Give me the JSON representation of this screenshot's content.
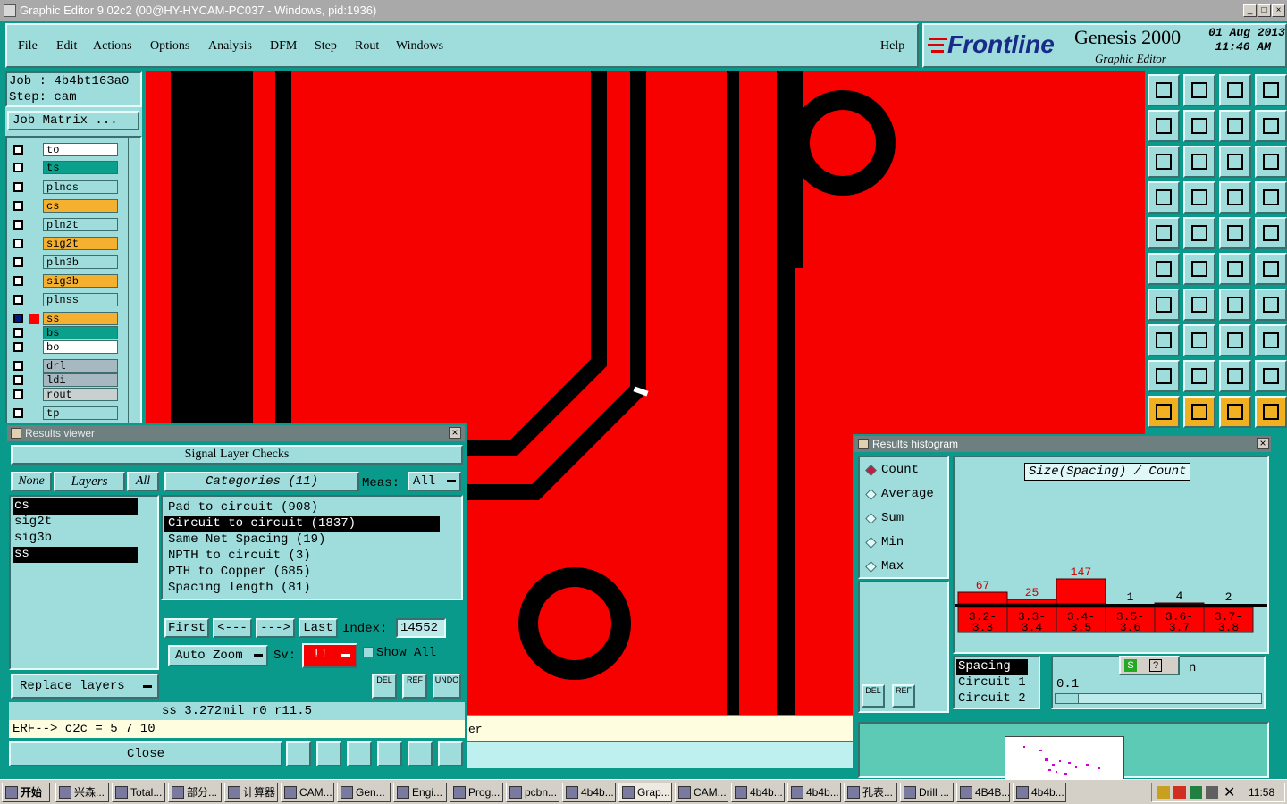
{
  "window": {
    "title": "Graphic Editor 9.02c2 (00@HY-HYCAM-PC037 - Windows, pid:1936)",
    "min": "_",
    "max": "□",
    "close": "×"
  },
  "menu": {
    "items": [
      "File",
      "Edit",
      "Actions",
      "Options",
      "Analysis",
      "DFM",
      "Step",
      "Rout",
      "Windows"
    ],
    "help": "Help"
  },
  "logo": {
    "brand": "Frontline",
    "product": "Genesis 2000",
    "subtitle": "Graphic Editor",
    "date": "01 Aug 2013",
    "time": "11:46 AM"
  },
  "job": {
    "job_line": "Job : 4b4bt163a0",
    "step_line": "Step: cam",
    "matrix_button": "Job Matrix ..."
  },
  "layers": [
    {
      "name": "to",
      "color": "#ffffff"
    },
    {
      "name": "ts",
      "color": "#0aa08c"
    },
    {
      "name": "plncs",
      "color": "#9fdcdc"
    },
    {
      "name": "cs",
      "color": "#f6b030"
    },
    {
      "name": "pln2t",
      "color": "#9fdcdc"
    },
    {
      "name": "sig2t",
      "color": "#f6b030"
    },
    {
      "name": "pln3b",
      "color": "#9fdcdc"
    },
    {
      "name": "sig3b",
      "color": "#f6b030"
    },
    {
      "name": "plnss",
      "color": "#9fdcdc"
    },
    {
      "name": "ss",
      "color": "#f6b030"
    },
    {
      "name": "bs",
      "color": "#0aa08c"
    },
    {
      "name": "bo",
      "color": "#ffffff"
    },
    {
      "name": "drl",
      "color": "#a8b8c0"
    },
    {
      "name": "ldi",
      "color": "#a8b8c0"
    },
    {
      "name": "rout",
      "color": "#c8d0d0"
    },
    {
      "name": "tp",
      "color": "#9fdcdc"
    }
  ],
  "results_viewer": {
    "title": "Results viewer",
    "header": "Signal Layer Checks",
    "none_btn": "None",
    "layers_btn": "Layers",
    "all_btn": "All",
    "categories_btn": "Categories (11)",
    "meas_label": "Meas:",
    "meas_value": "All",
    "layer_list": [
      "cs",
      "sig2t",
      "sig3b",
      "ss"
    ],
    "categories": [
      "Pad to circuit (908)",
      "Circuit to circuit (1837)",
      "Same Net Spacing (19)",
      "NPTH to circuit (3)",
      "PTH to Copper (685)",
      "Spacing length (81)"
    ],
    "first": "First",
    "prev": "<---",
    "next": "--->",
    "last": "Last",
    "index_label": "Index:",
    "index_value": "14552",
    "auto_zoom": "Auto Zoom",
    "sv_label": "Sv:",
    "sv_value": "!!",
    "show_all": "Show All",
    "replace_layers": "Replace layers",
    "del": "DEL",
    "ref": "REF",
    "undo": "UNDO",
    "status": "ss 3.272mil  r0  r11.5",
    "erf": "ERF--> c2c = 5 7 10",
    "close": "Close"
  },
  "canvas_msg": "er",
  "histogram": {
    "title": "Results histogram",
    "modes": [
      "Count",
      "Average",
      "Sum",
      "Min",
      "Max"
    ],
    "chart_title": "Size(Spacing) / Count",
    "del": "DEL",
    "ref": "REF",
    "props": [
      "Spacing",
      "Circuit 1",
      "Circuit 2"
    ],
    "value": "0.1",
    "unit_fragment": "n",
    "chart_data": {
      "type": "bar",
      "title": "Size(Spacing) / Count",
      "categories": [
        "3.2-3.3",
        "3.3-3.4",
        "3.4-3.5",
        "3.5-3.6",
        "3.6-3.7",
        "3.7-3.8"
      ],
      "values": [
        67,
        25,
        147,
        1,
        4,
        2
      ]
    }
  },
  "taskbar": {
    "start": "开始",
    "tasks": [
      "兴森...",
      "Total...",
      "部分...",
      "计算器",
      "CAM...",
      "Gen...",
      "Engi...",
      "Prog...",
      "pcbn...",
      "4b4b...",
      "Grap...",
      "CAM...",
      "4b4b...",
      "4b4b...",
      "孔表...",
      "Drill ...",
      "4B4B...",
      "4b4b..."
    ],
    "clock": "11:58"
  },
  "colors": {
    "copper": "#f70000",
    "teal": "#9fdcdc",
    "dark_teal": "#0a9a8c",
    "highlight": "#f6b030"
  }
}
